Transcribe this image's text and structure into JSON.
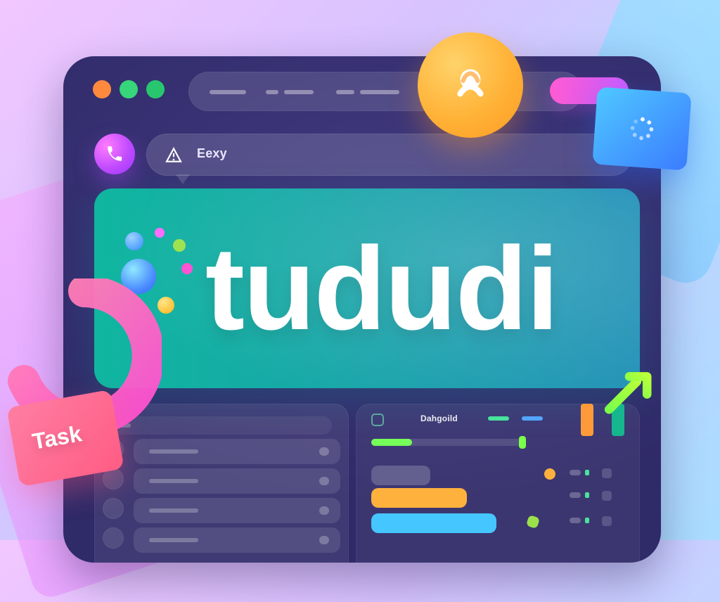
{
  "search": {
    "text": "Eexy"
  },
  "hero": {
    "brand": "tududi"
  },
  "tag": {
    "label": "Task"
  },
  "right_panel": {
    "title": "Dahgoild"
  },
  "icons": {
    "phone": "phone-icon",
    "profile": "profile-icon",
    "loader": "loading-icon",
    "search_left": "alert-icon",
    "search_right": "search-icon",
    "arrow": "arrow-up-right-icon"
  },
  "progress": {
    "primary_fraction": 0.26
  },
  "colors": {
    "accent_orange": "#ffb237",
    "accent_blue": "#3b7cff",
    "accent_teal": "#10b6a0",
    "accent_pink": "#ff5c84",
    "accent_green": "#76ff5a"
  }
}
